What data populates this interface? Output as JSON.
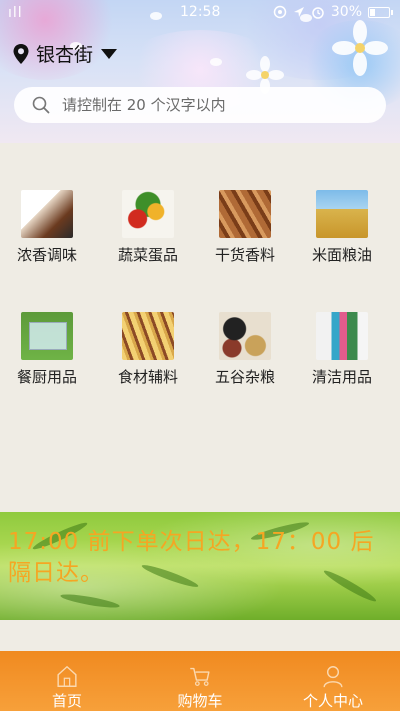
{
  "status_bar": {
    "signal": "ıll",
    "time": "12:58",
    "battery": "30%",
    "battery_level": 0.3
  },
  "header": {
    "location_icon": "map-pin-icon",
    "location": "银杏街",
    "dropdown_icon": "caret-down-icon"
  },
  "search": {
    "icon": "search-icon",
    "placeholder": "请控制在 20 个汉字以内"
  },
  "categories": [
    {
      "label": "浓香调味",
      "icon": "seasoning-thumbnail"
    },
    {
      "label": "蔬菜蛋品",
      "icon": "vegetables-thumbnail"
    },
    {
      "label": "干货香料",
      "icon": "dried-goods-thumbnail"
    },
    {
      "label": "米面粮油",
      "icon": "rice-flour-thumbnail"
    },
    {
      "label": "餐厨用品",
      "icon": "kitchenware-thumbnail"
    },
    {
      "label": "食材辅料",
      "icon": "ingredients-thumbnail"
    },
    {
      "label": "五谷杂粮",
      "icon": "grains-thumbnail"
    },
    {
      "label": "清洁用品",
      "icon": "cleaning-thumbnail"
    }
  ],
  "banner": {
    "text": "17:00 前下单次日达，17：00 后隔日达。",
    "text_color": "#f5a623"
  },
  "tabs": [
    {
      "label": "首页",
      "icon": "home-icon"
    },
    {
      "label": "购物车",
      "icon": "cart-icon"
    },
    {
      "label": "个人中心",
      "icon": "user-icon"
    }
  ],
  "colors": {
    "tab_bar": "#f39427",
    "page_background": "#efece4"
  }
}
